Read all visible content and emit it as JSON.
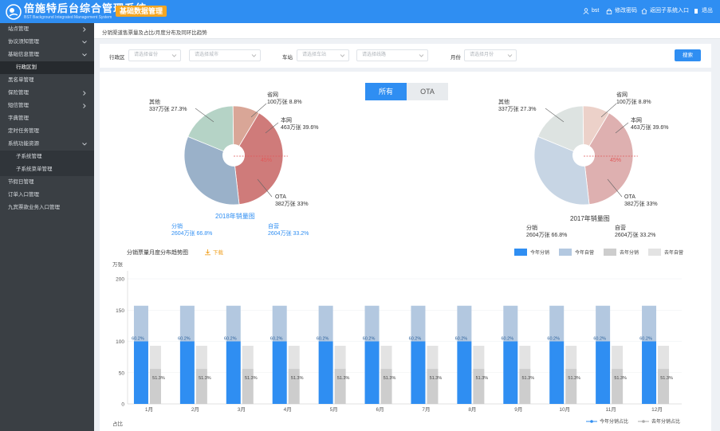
{
  "header": {
    "title": "倍施特后台综合管理系统",
    "subtitle": "BST Background Integrated Management System",
    "badge": "基础数据管理",
    "user": "bst",
    "change_password": "修改密码",
    "subsystem_entry": "返回子系统入口",
    "logout": "退出"
  },
  "sidebar": {
    "items": [
      {
        "label": "站点管理",
        "expand": "right",
        "sub": false,
        "active": false
      },
      {
        "label": "协议须知管理",
        "expand": "down",
        "sub": false,
        "active": false
      },
      {
        "label": "基础信息管理",
        "expand": "down",
        "sub": false,
        "active": false
      },
      {
        "label": "行政区划",
        "expand": "",
        "sub": true,
        "active": true
      },
      {
        "label": "黑名单管理",
        "expand": "",
        "sub": false,
        "active": false
      },
      {
        "label": "保险管理",
        "expand": "right",
        "sub": false,
        "active": false
      },
      {
        "label": "短信管理",
        "expand": "right",
        "sub": false,
        "active": false
      },
      {
        "label": "字典管理",
        "expand": "",
        "sub": false,
        "active": false
      },
      {
        "label": "定时任务管理",
        "expand": "",
        "sub": false,
        "active": false
      },
      {
        "label": "系统功能资源",
        "expand": "down",
        "sub": false,
        "active": false
      },
      {
        "label": "子系统管理",
        "expand": "",
        "sub": true,
        "active": false
      },
      {
        "label": "子系统菜单管理",
        "expand": "",
        "sub": true,
        "active": false
      },
      {
        "label": "节假日管理",
        "expand": "",
        "sub": false,
        "active": false
      },
      {
        "label": "订单入口管理",
        "expand": "",
        "sub": false,
        "active": false
      },
      {
        "label": "九宾票款业务入口管理",
        "expand": "",
        "sub": false,
        "active": false
      }
    ]
  },
  "breadcrumb": "分销渠道售票量及占比/月度分布及同环比趋势",
  "filters": {
    "region_label": "行政区",
    "province_placeholder": "请选择省份",
    "city_placeholder": "请选择城市",
    "station_label": "车站",
    "station_placeholder": "请选择车站",
    "line_placeholder": "请选择线路",
    "month_label": "月份",
    "month_placeholder": "请选择月份",
    "search": "搜索"
  },
  "tabs": [
    "所有",
    "OTA"
  ],
  "pies": [
    {
      "caption": "2018年销量图",
      "slices": [
        {
          "name": "其他",
          "value_text": "337万张",
          "pct_text": "27.3%",
          "pct": 27.3,
          "color": "#b5d3c6"
        },
        {
          "name": "省网",
          "value_text": "100万张",
          "pct_text": "8.8%",
          "pct": 8.8,
          "color": "#d9a697"
        },
        {
          "name": "本网",
          "value_text": "463万张",
          "pct_text": "39.6%",
          "pct": 39.6,
          "color": "#cf7b7a"
        },
        {
          "name": "OTA",
          "value_text": "382万张",
          "pct_text": "33%",
          "pct": 33,
          "color": "#9ab1c9"
        }
      ],
      "threshold": "45%",
      "left_summary": {
        "label": "分销",
        "value": "2604万张 66.8%"
      },
      "right_summary": {
        "label": "自营",
        "value": "2604万张 33.2%"
      }
    },
    {
      "caption": "2017年销量图",
      "slices": [
        {
          "name": "其他",
          "value_text": "337万张",
          "pct_text": "27.3%",
          "pct": 27.3,
          "color": "#dde3e1"
        },
        {
          "name": "省网",
          "value_text": "100万张",
          "pct_text": "8.8%",
          "pct": 8.8,
          "color": "#ecd1c9"
        },
        {
          "name": "本网",
          "value_text": "463万张",
          "pct_text": "39.6%",
          "pct": 39.6,
          "color": "#deb0b0"
        },
        {
          "name": "OTA",
          "value_text": "382万张",
          "pct_text": "33%",
          "pct": 33,
          "color": "#c7d5e4"
        }
      ],
      "threshold": "45%",
      "left_summary": {
        "label": "分销",
        "value": "2604万张 66.8%"
      },
      "right_summary": {
        "label": "自营",
        "value": "2604万张 33.2%"
      }
    }
  ],
  "bar_section": {
    "title": "分销票量月度分布趋势图",
    "download": "下载"
  },
  "chart_data": {
    "type": "bar",
    "categories": [
      "1月",
      "2月",
      "3月",
      "4月",
      "5月",
      "6月",
      "7月",
      "8月",
      "9月",
      "10月",
      "11月",
      "12月"
    ],
    "series": [
      {
        "name": "今年分销",
        "values": [
          100,
          100,
          100,
          100,
          100,
          100,
          100,
          100,
          100,
          100,
          100,
          100
        ],
        "color": "#2f8ef2"
      },
      {
        "name": "今年自营",
        "values": [
          57,
          57,
          57,
          57,
          57,
          57,
          57,
          57,
          57,
          57,
          57,
          57
        ],
        "color": "#b3c8e0",
        "stack": "this_year"
      },
      {
        "name": "去年分销",
        "values": [
          56,
          56,
          56,
          56,
          56,
          56,
          56,
          56,
          56,
          56,
          56,
          56
        ],
        "color": "#cdcdcd"
      },
      {
        "name": "去年自营",
        "values": [
          37,
          37,
          37,
          37,
          37,
          37,
          37,
          37,
          37,
          37,
          37,
          37
        ],
        "color": "#e3e3e3",
        "stack": "last_year"
      }
    ],
    "ratio_series": [
      {
        "name": "今年分销占比",
        "values": [
          60.2,
          60.2,
          60.2,
          60.2,
          60.2,
          60.2,
          60.2,
          60.2,
          60.2,
          60.2,
          60.2,
          60.2
        ],
        "labels": [
          "60.2%",
          "60.2%",
          "60.2%",
          "60.2%",
          "60.2%",
          "60.2%",
          "60.2%",
          "60.2%",
          "60.2%",
          "60.2%",
          "60.2%",
          "60.2%"
        ]
      },
      {
        "name": "去年分销占比",
        "values": [
          51.3,
          51.3,
          51.3,
          51.3,
          51.3,
          51.3,
          51.3,
          51.3,
          51.3,
          51.3,
          51.3,
          51.3
        ],
        "labels": [
          "51.3%",
          "51.3%",
          "51.3%",
          "51.3%",
          "51.3%",
          "51.3%",
          "51.3%",
          "51.3%",
          "51.3%",
          "51.3%",
          "51.3%",
          "51.3%"
        ]
      }
    ],
    "yunit": "万张",
    "y2label": "占比",
    "ylim": [
      0,
      200
    ],
    "yticks": [
      0,
      50,
      100,
      150,
      200
    ],
    "legend": "top-right"
  }
}
